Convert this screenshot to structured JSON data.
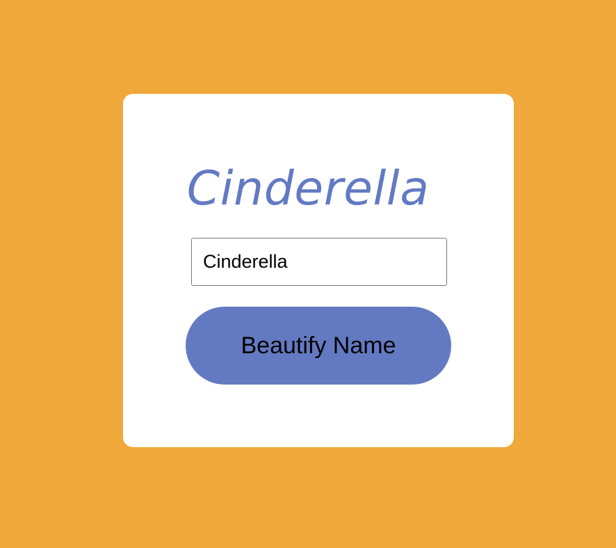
{
  "colors": {
    "background": "#F0A83B",
    "card": "#FFFFFF",
    "accent": "#637AC3"
  },
  "card": {
    "display_name": "Cinderella",
    "name_input": {
      "value": "Cinderella"
    },
    "beautify_button_label": "Beautify Name"
  }
}
